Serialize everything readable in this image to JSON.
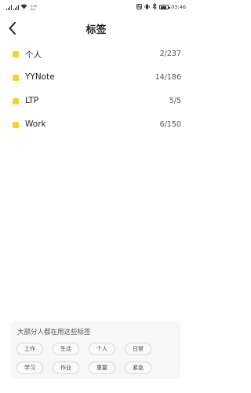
{
  "status_bar": {
    "network_small": "0.00",
    "network_unit": "K/s",
    "time": "03:46",
    "battery_level": 0.85
  },
  "header": {
    "title": "标签"
  },
  "tags": [
    {
      "name": "个人",
      "count": "2/237"
    },
    {
      "name": "YYNote",
      "count": "14/186"
    },
    {
      "name": "LTP",
      "count": "5/5"
    },
    {
      "name": "Work",
      "count": "6/150"
    }
  ],
  "suggestions": {
    "title": "大部分人都在用这些标签",
    "chips": [
      "工作",
      "生活",
      "个人",
      "日常",
      "学习",
      "作业",
      "重要",
      "紧急"
    ]
  },
  "colors": {
    "tag_accent": "#f6d22b"
  }
}
